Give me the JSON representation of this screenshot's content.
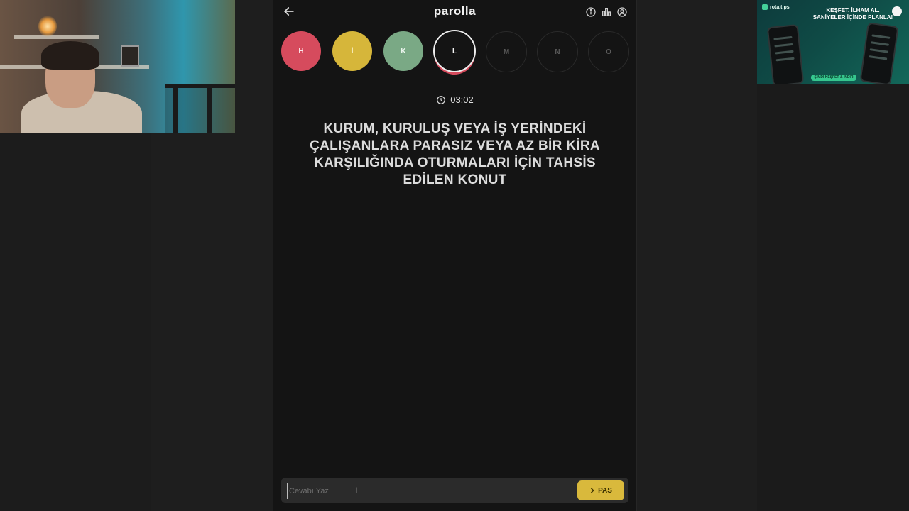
{
  "app": {
    "brand": "parolla",
    "timer": "03:02",
    "question": "KURUM, KURULUŞ VEYA İŞ YERİNDEKİ ÇALIŞANLARA PARASIZ VEYA AZ BİR KİRA KARŞILIĞINDA OTURMALARI İÇİN TAHSİS EDİLEN KONUT"
  },
  "icons": {
    "back": "arrow-left-icon",
    "info": "info-icon",
    "stats": "bar-chart-icon",
    "profile": "user-circle-icon",
    "timer": "clock-icon",
    "pass": "chevron-right-icon"
  },
  "letters": [
    {
      "label": "H",
      "state": "wrong",
      "color": "#d64b5d"
    },
    {
      "label": "İ",
      "state": "pass",
      "color": "#d6b63a"
    },
    {
      "label": "K",
      "state": "correct",
      "color": "#7aa985"
    },
    {
      "label": "L",
      "state": "active",
      "color": "#141414"
    },
    {
      "label": "M",
      "state": "pending",
      "color": "#141414"
    },
    {
      "label": "N",
      "state": "pending",
      "color": "#141414"
    },
    {
      "label": "O",
      "state": "pending",
      "color": "#141414"
    }
  ],
  "answer": {
    "placeholder": "Cevabı Yaz",
    "value": "",
    "pass_label": "PAS"
  },
  "ad": {
    "logo": "rota.tips",
    "title_line1": "KEŞFET. İLHAM AL.",
    "title_line2": "SANİYELER İÇİNDE PLANLA!",
    "cta": "ŞİMDİ KEŞFET & İNDİR"
  },
  "colors": {
    "accent": "#d9b93c",
    "wrong": "#d64b5d",
    "correct": "#7aa985",
    "background": "#141414"
  }
}
